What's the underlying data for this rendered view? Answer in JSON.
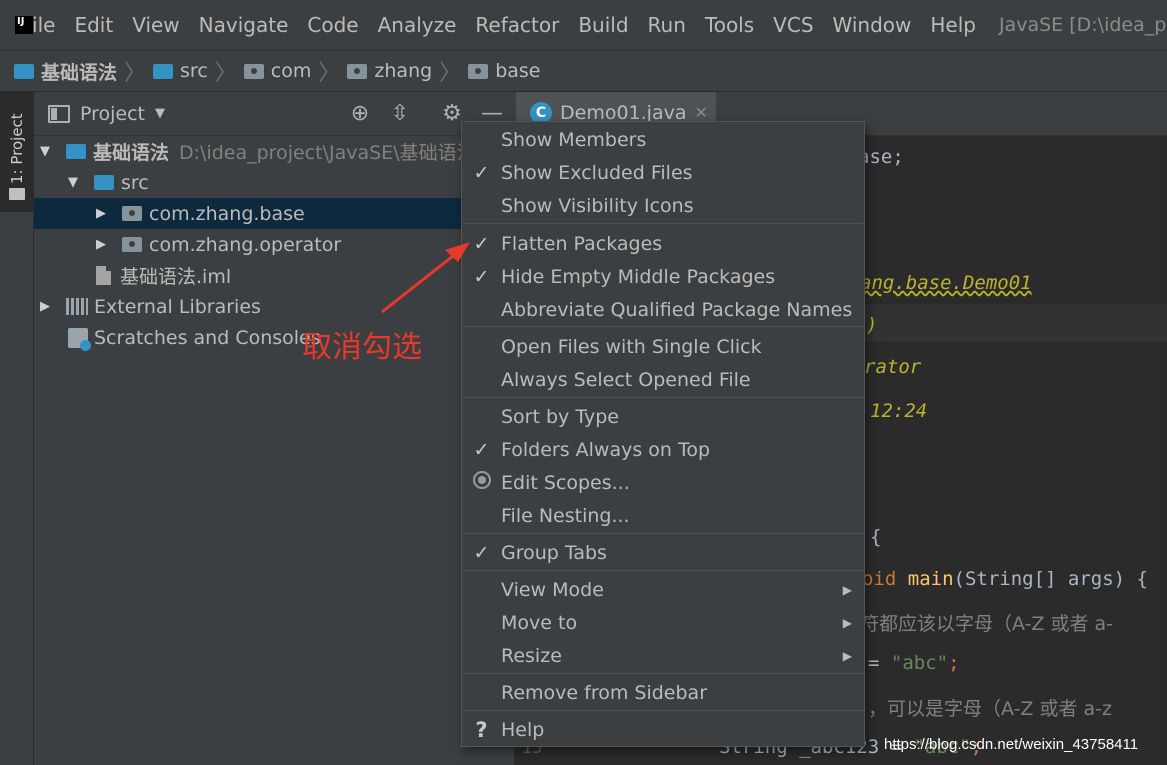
{
  "menubar": {
    "items": [
      "File",
      "Edit",
      "View",
      "Navigate",
      "Code",
      "Analyze",
      "Refactor",
      "Build",
      "Run",
      "Tools",
      "VCS",
      "Window",
      "Help"
    ],
    "window_title": "JavaSE [D:\\idea_proj"
  },
  "breadcrumb": {
    "items": [
      "基础语法",
      "src",
      "com",
      "zhang",
      "base"
    ]
  },
  "tool_strip": {
    "project_label": "1: Project"
  },
  "project_panel": {
    "title": "Project",
    "tree": {
      "root_label": "基础语法",
      "root_path": "D:\\idea_project\\JavaSE\\基础语法",
      "src_label": "src",
      "pkg_base": "com.zhang.base",
      "pkg_operator": "com.zhang.operator",
      "iml_file": "基础语法.iml",
      "external_libraries": "External Libraries",
      "scratches": "Scratches and Consoles"
    }
  },
  "editor": {
    "tab_label": "Demo01.java",
    "lines": {
      "l1": "ase;",
      "l2": "ang.base.Demo01",
      "l3": ")",
      "l4": "rator",
      "l5": "12:24",
      "l6": "{",
      "l7_kw": "oid ",
      "l7_fn": "main",
      "l7_rest": "(String[] args) {",
      "l8": "符都应该以字母（A-Z 或者 a-",
      "l9_a": "= ",
      "l9_str": "\"abc\"",
      "l9_b": ";",
      "l10": "，可以是字母（A-Z 或者 a-z",
      "l11_a": "String _abc123 = ",
      "l11_str": "\"abc\"",
      "l11_b": ";",
      "line_number": "15"
    }
  },
  "context_menu": {
    "items": [
      {
        "label": "Show Members",
        "checked": false
      },
      {
        "label": "Show Excluded Files",
        "checked": true
      },
      {
        "label": "Show Visibility Icons",
        "checked": false
      },
      {
        "label": "Flatten Packages",
        "checked": true
      },
      {
        "label": "Hide Empty Middle Packages",
        "checked": true
      },
      {
        "label": "Abbreviate Qualified Package Names",
        "checked": false
      },
      {
        "label": "Open Files with Single Click",
        "checked": false
      },
      {
        "label": "Always Select Opened File",
        "checked": false
      },
      {
        "label": "Sort by Type",
        "checked": false
      },
      {
        "label": "Folders Always on Top",
        "checked": true
      },
      {
        "label": "Edit Scopes...",
        "icon": "radio"
      },
      {
        "label": "File Nesting...",
        "checked": false
      },
      {
        "label": "Group Tabs",
        "checked": true
      },
      {
        "label": "View Mode",
        "submenu": true
      },
      {
        "label": "Move to",
        "submenu": true
      },
      {
        "label": "Resize",
        "submenu": true
      },
      {
        "label": "Remove from Sidebar",
        "checked": false
      },
      {
        "label": "Help",
        "icon": "question"
      }
    ],
    "check_glyph": "✓"
  },
  "annotation": {
    "text": "取消勾选",
    "color": "#e8372b"
  },
  "watermark": "https://blog.csdn.net/weixin_43758411",
  "colors": {
    "background": "#3c3f41",
    "editor_bg": "#2b2b2b",
    "selection": "#0d293e",
    "accent_blue": "#3592c4"
  }
}
